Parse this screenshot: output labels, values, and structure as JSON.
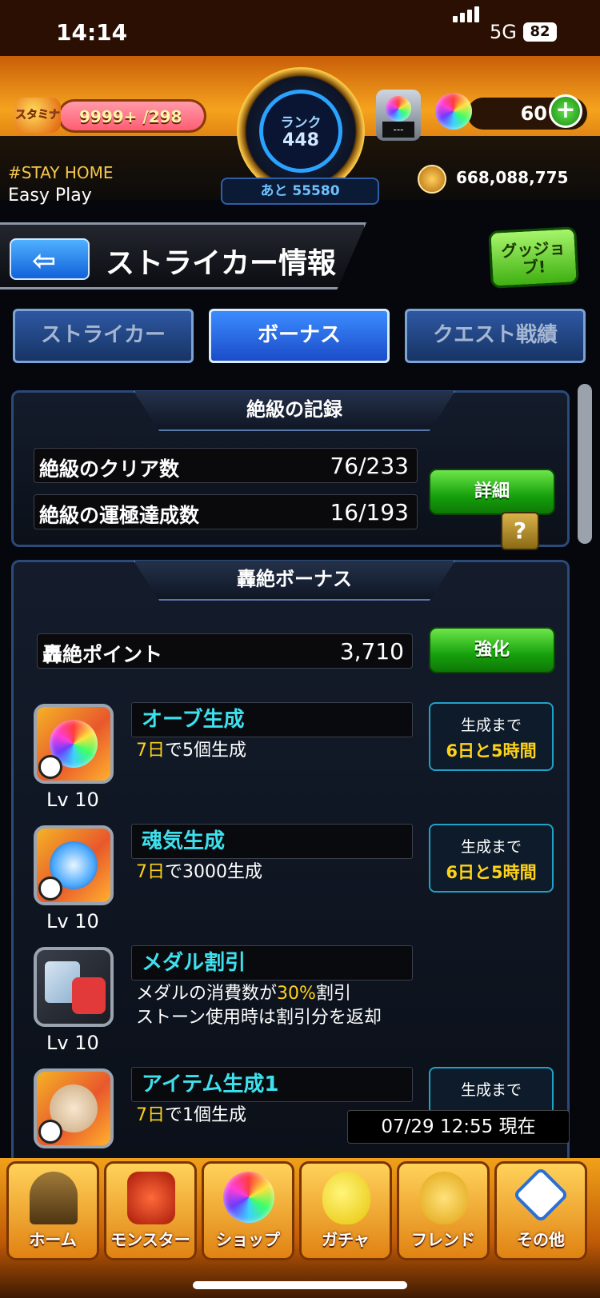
{
  "status_bar": {
    "time": "14:14",
    "network": "5G",
    "battery": "82"
  },
  "header": {
    "stamina_icon_label": "スタミナ",
    "stamina_value": "9999+",
    "stamina_max": "/298",
    "stamina_fill_fraction": 1.0,
    "rank_label": "ランク",
    "rank_value": "448",
    "rank_next": "あと 55580",
    "item_slot": "---",
    "orb_count": "60",
    "plus_label": "+",
    "tagline": "#STAY HOME",
    "mode": "Easy Play",
    "gold": "668,088,775"
  },
  "title_bar": {
    "back_arrow": "⇦",
    "title": "ストライカー情報",
    "good_job": "グッジョブ!"
  },
  "tabs": [
    {
      "label": "ストライカー",
      "active": false
    },
    {
      "label": "ボーナス",
      "active": true
    },
    {
      "label": "クエスト戦績",
      "active": false
    }
  ],
  "extreme_record": {
    "heading": "絶級の記録",
    "rows": [
      {
        "label": "絶級のクリア数",
        "value": "76/233"
      },
      {
        "label": "絶級の運極達成数",
        "value": "16/193"
      }
    ],
    "detail_button": "詳細"
  },
  "bonus": {
    "heading": "轟絶ボーナス",
    "help_label": "?",
    "points_label": "轟絶ポイント",
    "points_value": "3,710",
    "upgrade_button": "強化",
    "items": [
      {
        "name": "オーブ生成",
        "desc_hl": "7日",
        "desc": "で5個生成",
        "level": "Lv 10",
        "time_label": "生成まで",
        "time_value": "6日と5時間"
      },
      {
        "name": "魂気生成",
        "desc_hl": "7日",
        "desc": "で3000生成",
        "level": "Lv 10",
        "time_label": "生成まで",
        "time_value": "6日と5時間"
      },
      {
        "name": "メダル割引",
        "desc_pre": "メダルの消費数が",
        "desc_hl": "30%",
        "desc_post": "割引",
        "desc_line2": "ストーン使用時は割引分を返却",
        "level": "Lv 10"
      },
      {
        "name": "アイテム生成1",
        "desc_hl": "7日",
        "desc": "で1個生成",
        "time_label": "生成まで"
      }
    ],
    "timestamp": "07/29 12:55 現在"
  },
  "nav": [
    {
      "label": "ホーム",
      "icon": "home-gate-icon"
    },
    {
      "label": "モンスター",
      "icon": "monster-icon"
    },
    {
      "label": "ショップ",
      "icon": "orb-icon"
    },
    {
      "label": "ガチャ",
      "icon": "egg-icon"
    },
    {
      "label": "フレンド",
      "icon": "friends-icon"
    },
    {
      "label": "その他",
      "icon": "question-icon"
    }
  ],
  "colors": {
    "accent_orange": "#f5a31e",
    "tab_blue": "#1c4cc8",
    "green_button": "#16a10c",
    "cyan_text": "#3ee0ee",
    "yellow_text": "#ffd21a"
  }
}
